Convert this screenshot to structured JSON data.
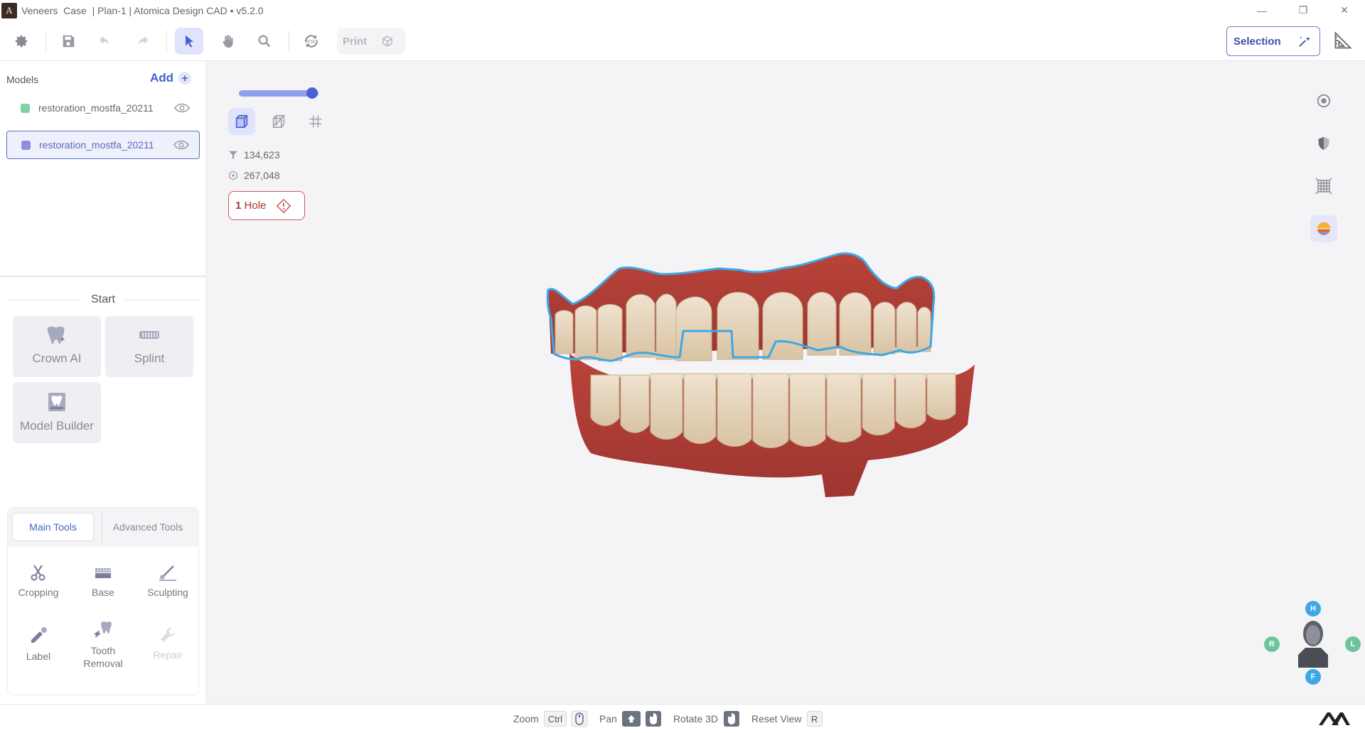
{
  "window": {
    "logo_letter": "A",
    "title": "Veneers  Case  | Plan-1 | Atomica Design CAD • v5.2.0",
    "minimize": "—",
    "restore": "❐",
    "close": "✕"
  },
  "toolbar": {
    "print_label": "Print",
    "selection_label": "Selection"
  },
  "models": {
    "header": "Models",
    "add_label": "Add",
    "add_plus": "+",
    "items": [
      {
        "name": "restoration_mostfa_20211",
        "color": "#7ed3a6"
      },
      {
        "name": "restoration_mostfa_20211",
        "color": "#8a8fe0"
      }
    ]
  },
  "start": {
    "label": "Start",
    "tiles": [
      "Crown AI",
      "Splint",
      "Model Builder"
    ]
  },
  "tools": {
    "tabs": [
      "Main Tools",
      "Advanced Tools"
    ],
    "items": [
      "Cropping",
      "Base",
      "Sculpting",
      "Label",
      "Tooth Removal",
      "Repair"
    ]
  },
  "viewport": {
    "slider_fraction": 0.92,
    "stats": {
      "triangles": "134,623",
      "vertices": "267,048"
    },
    "hole_count": "1",
    "hole_label": "Hole"
  },
  "orientation": {
    "top": "H",
    "right_side": "R",
    "left_side": "L",
    "front": "F"
  },
  "status": {
    "zoom_label": "Zoom",
    "zoom_key": "Ctrl",
    "pan_label": "Pan",
    "rotate_label": "Rotate 3D",
    "reset_label": "Reset View",
    "reset_key": "R"
  },
  "colors": {
    "accent": "#4660c8",
    "warning": "#c85a58",
    "mesh_outline": "#3da8e6"
  }
}
